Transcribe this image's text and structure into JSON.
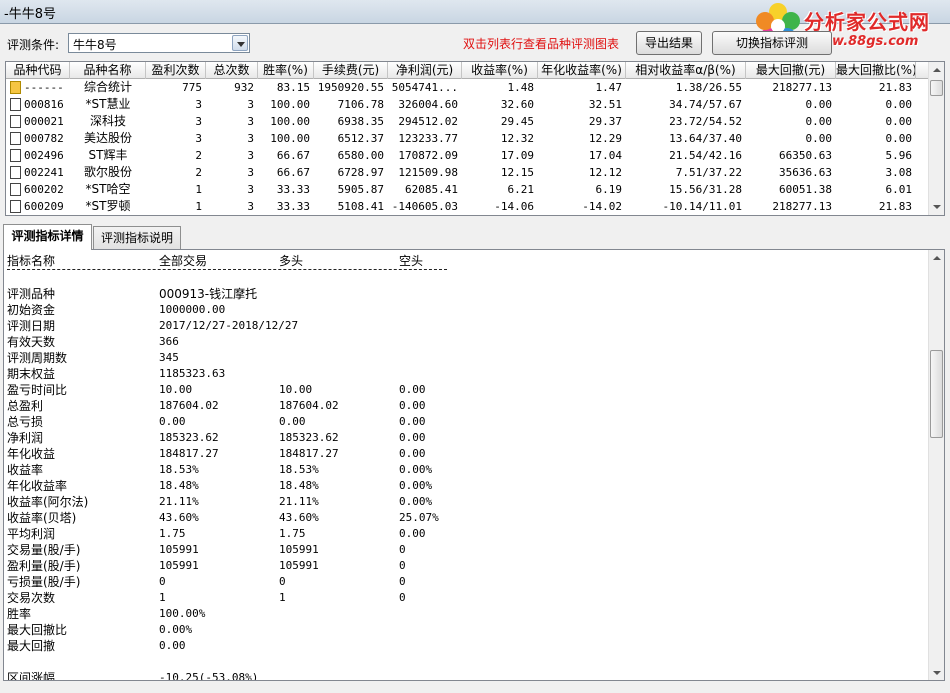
{
  "window": {
    "title": "-牛牛8号"
  },
  "logo": {
    "brand": "分析家公式网",
    "site": "www.88gs.com"
  },
  "toolbar": {
    "cond_label": "评测条件:",
    "cond_value": "牛牛8号",
    "hint": "双击列表行查看品种评测图表",
    "export_label": "导出结果",
    "switch_label": "切换指标评测"
  },
  "table": {
    "headers": [
      "品种代码",
      "品种名称",
      "盈利次数",
      "总次数",
      "胜率(%)",
      "手续费(元)",
      "净利润(元)",
      "收益率(%)",
      "年化收益率(%)",
      "相对收益率α/β(%)",
      "最大回撤(元)",
      "最大回撤比(%)"
    ],
    "rows": [
      {
        "code": "------",
        "name": "综合统计",
        "wins": "775",
        "total": "932",
        "winrate": "83.15",
        "fee": "1950920.55",
        "profit": "5054741...",
        "ret": "1.48",
        "annual": "1.47",
        "relative": "1.38/26.55",
        "dd": "218277.13",
        "ddr": "21.83",
        "summary": true
      },
      {
        "code": "000816",
        "name": "*ST慧业",
        "wins": "3",
        "total": "3",
        "winrate": "100.00",
        "fee": "7106.78",
        "profit": "326004.60",
        "ret": "32.60",
        "annual": "32.51",
        "relative": "34.74/57.67",
        "dd": "0.00",
        "ddr": "0.00"
      },
      {
        "code": "000021",
        "name": "深科技",
        "wins": "3",
        "total": "3",
        "winrate": "100.00",
        "fee": "6938.35",
        "profit": "294512.02",
        "ret": "29.45",
        "annual": "29.37",
        "relative": "23.72/54.52",
        "dd": "0.00",
        "ddr": "0.00"
      },
      {
        "code": "000782",
        "name": "美达股份",
        "wins": "3",
        "total": "3",
        "winrate": "100.00",
        "fee": "6512.37",
        "profit": "123233.77",
        "ret": "12.32",
        "annual": "12.29",
        "relative": "13.64/37.40",
        "dd": "0.00",
        "ddr": "0.00"
      },
      {
        "code": "002496",
        "name": "ST辉丰",
        "wins": "2",
        "total": "3",
        "winrate": "66.67",
        "fee": "6580.00",
        "profit": "170872.09",
        "ret": "17.09",
        "annual": "17.04",
        "relative": "21.54/42.16",
        "dd": "66350.63",
        "ddr": "5.96"
      },
      {
        "code": "002241",
        "name": "歌尔股份",
        "wins": "2",
        "total": "3",
        "winrate": "66.67",
        "fee": "6728.97",
        "profit": "121509.98",
        "ret": "12.15",
        "annual": "12.12",
        "relative": "7.51/37.22",
        "dd": "35636.63",
        "ddr": "3.08"
      },
      {
        "code": "600202",
        "name": "*ST哈空",
        "wins": "1",
        "total": "3",
        "winrate": "33.33",
        "fee": "5905.87",
        "profit": "62085.41",
        "ret": "6.21",
        "annual": "6.19",
        "relative": "15.56/31.28",
        "dd": "60051.38",
        "ddr": "6.01"
      },
      {
        "code": "600209",
        "name": "*ST罗顿",
        "wins": "1",
        "total": "3",
        "winrate": "33.33",
        "fee": "5108.41",
        "profit": "-140605.03",
        "ret": "-14.06",
        "annual": "-14.02",
        "relative": "-10.14/11.01",
        "dd": "218277.13",
        "ddr": "21.83"
      }
    ]
  },
  "tabs": {
    "detail": "评测指标详情",
    "explain": "评测指标说明"
  },
  "detail": {
    "header": {
      "name": "指标名称",
      "all": "全部交易",
      "long": "多头",
      "short": "空头"
    },
    "lines": [
      {
        "k": "评测品种",
        "a": "000913-钱江摩托",
        "l": "",
        "s": ""
      },
      {
        "k": "初始资金",
        "a": "1000000.00",
        "l": "",
        "s": ""
      },
      {
        "k": "评测日期",
        "a": "2017/12/27-2018/12/27",
        "l": "",
        "s": ""
      },
      {
        "k": "有效天数",
        "a": "366",
        "l": "",
        "s": ""
      },
      {
        "k": "评测周期数",
        "a": "345",
        "l": "",
        "s": ""
      },
      {
        "k": "期末权益",
        "a": "1185323.63",
        "l": "",
        "s": ""
      },
      {
        "k": "盈亏时间比",
        "a": "10.00",
        "l": "10.00",
        "s": "0.00"
      },
      {
        "k": "总盈利",
        "a": "187604.02",
        "l": "187604.02",
        "s": "0.00"
      },
      {
        "k": "总亏损",
        "a": "0.00",
        "l": "0.00",
        "s": "0.00"
      },
      {
        "k": "净利润",
        "a": "185323.62",
        "l": "185323.62",
        "s": "0.00"
      },
      {
        "k": "年化收益",
        "a": "184817.27",
        "l": "184817.27",
        "s": "0.00"
      },
      {
        "k": "收益率",
        "a": "18.53%",
        "l": "18.53%",
        "s": "0.00%"
      },
      {
        "k": "年化收益率",
        "a": "18.48%",
        "l": "18.48%",
        "s": "0.00%"
      },
      {
        "k": "收益率(阿尔法)",
        "a": "21.11%",
        "l": "21.11%",
        "s": "0.00%"
      },
      {
        "k": "收益率(贝塔)",
        "a": "43.60%",
        "l": "43.60%",
        "s": "25.07%"
      },
      {
        "k": "平均利润",
        "a": "1.75",
        "l": "1.75",
        "s": "0.00"
      },
      {
        "k": "交易量(股/手)",
        "a": "105991",
        "l": "105991",
        "s": "0"
      },
      {
        "k": "盈利量(股/手)",
        "a": "105991",
        "l": "105991",
        "s": "0"
      },
      {
        "k": "亏损量(股/手)",
        "a": "0",
        "l": "0",
        "s": "0"
      },
      {
        "k": "交易次数",
        "a": "1",
        "l": "1",
        "s": "0"
      },
      {
        "k": "胜率",
        "a": "100.00%",
        "l": "",
        "s": ""
      },
      {
        "k": "最大回撤比",
        "a": "0.00%",
        "l": "",
        "s": ""
      },
      {
        "k": "最大回撤",
        "a": "0.00",
        "l": "",
        "s": ""
      },
      {
        "k": "",
        "a": "",
        "l": "",
        "s": ""
      },
      {
        "k": "区间涨幅",
        "a": "-10.25(-53.08%)",
        "l": "",
        "s": ""
      }
    ]
  }
}
